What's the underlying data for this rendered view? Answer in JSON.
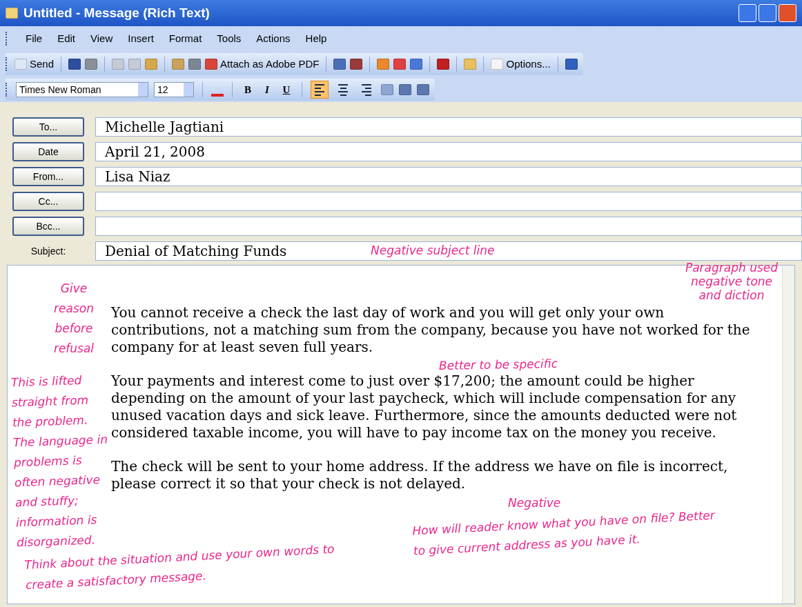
{
  "window": {
    "title": "Untitled - Message (Rich Text)"
  },
  "menu": [
    "File",
    "Edit",
    "View",
    "Insert",
    "Format",
    "Tools",
    "Actions",
    "Help"
  ],
  "toolbar": {
    "send": "Send",
    "attach": "Attach as Adobe PDF",
    "options": "Options..."
  },
  "format_bar": {
    "font": "Times New Roman",
    "size": "12",
    "bold": "B",
    "italic": "I",
    "underline": "U",
    "align": [
      {
        "kind": "left",
        "selected": true
      },
      {
        "kind": "center",
        "selected": false
      },
      {
        "kind": "right",
        "selected": false
      }
    ]
  },
  "header": [
    {
      "kind": "button",
      "label": "To...",
      "value": "Michelle Jagtiani"
    },
    {
      "kind": "button",
      "label": "Date",
      "value": "April 21, 2008"
    },
    {
      "kind": "button",
      "label": "From...",
      "value": "Lisa Niaz"
    },
    {
      "kind": "button",
      "label": "Cc..."
    },
    {
      "kind": "button",
      "label": "Bcc..."
    },
    {
      "kind": "label",
      "label": "Subject:",
      "value": "Denial of Matching Funds"
    }
  ],
  "body": [
    [
      "You cannot receive a check the last day of work and you will get only your own",
      "contributions, not a matching sum from the company, because you have not worked for the",
      "company for at least seven full years."
    ],
    [
      "Your payments and interest come to just over $17,200; the amount could be higher",
      "depending on the amount of your last paycheck, which will include compensation for any",
      "unused vacation days and sick leave. Furthermore, since the amounts deducted were not",
      "considered taxable income, you will have to pay income tax on the money you receive."
    ],
    [
      "The check will be sent to your home address. If the address we have on file is incorrect,",
      "please correct it so that your check is not delayed."
    ]
  ],
  "annotations": [
    "Negative subject line",
    "Paragraph used negative tone and diction",
    "Give reason before refusal",
    "Better to be specific",
    "This is lifted straight from the problem. The language in problems is often negative and stuffy; information is disorganized.",
    "Negative",
    "How will reader know what you have on file? Better to give current address as you have it.",
    "Think about the situation and use your own words to create a satisfactory message."
  ]
}
